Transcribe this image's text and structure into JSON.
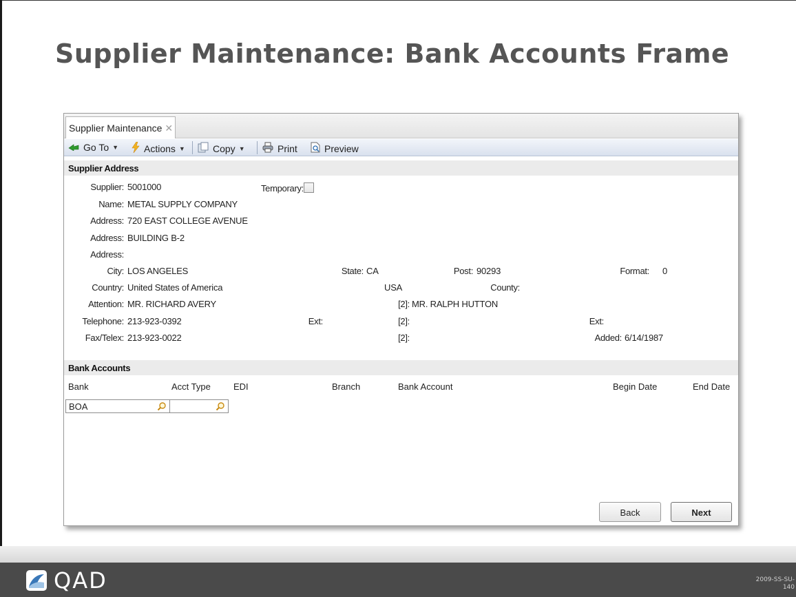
{
  "slide": {
    "title": "Supplier Maintenance: Bank Accounts Frame",
    "code_line1": "2009-SS-SU-",
    "code_line2": "140",
    "logo_text": "QAD"
  },
  "window": {
    "tab_label": "Supplier Maintenance",
    "tab_close": "✕",
    "toolbar": {
      "goto": "Go To",
      "actions": "Actions",
      "copy": "Copy",
      "print": "Print",
      "preview": "Preview",
      "caret": "▼"
    }
  },
  "address": {
    "section_title": "Supplier Address",
    "supplier_label": "Supplier:",
    "supplier": "5001000",
    "temporary_label": "Temporary:",
    "temporary_checked": false,
    "name_label": "Name:",
    "name": "METAL SUPPLY COMPANY",
    "address1_label": "Address:",
    "address1": "720 EAST COLLEGE AVENUE",
    "address2_label": "Address:",
    "address2": "BUILDING B-2",
    "address3_label": "Address:",
    "address3": "",
    "city_label": "City:",
    "city": "LOS ANGELES",
    "state_label": "State:",
    "state": "CA",
    "post_label": "Post:",
    "post": "90293",
    "format_label": "Format:",
    "format": "0",
    "country_label": "Country:",
    "country": "United States of America",
    "country_code": "USA",
    "county_label": "County:",
    "county": "",
    "attention_label": "Attention:",
    "attention": "MR. RICHARD AVERY",
    "attention2_label": "[2]:",
    "attention2": "MR. RALPH HUTTON",
    "telephone_label": "Telephone:",
    "telephone": "213-923-0392",
    "ext_label": "Ext:",
    "ext": "",
    "telephone2_label": "[2]:",
    "telephone2": "",
    "ext2_label": "Ext:",
    "ext2": "",
    "fax_label": "Fax/Telex:",
    "fax": "213-923-0022",
    "fax2_label": "[2]:",
    "fax2": "",
    "added_label": "Added:",
    "added": "6/14/1987"
  },
  "bank": {
    "section_title": "Bank Accounts",
    "columns": [
      "Bank",
      "Acct Type",
      "EDI",
      "Branch",
      "Bank Account",
      "Begin Date",
      "End Date"
    ],
    "row": {
      "bank": "BOA",
      "acct_type": ""
    }
  },
  "buttons": {
    "back": "Back",
    "next": "Next"
  }
}
